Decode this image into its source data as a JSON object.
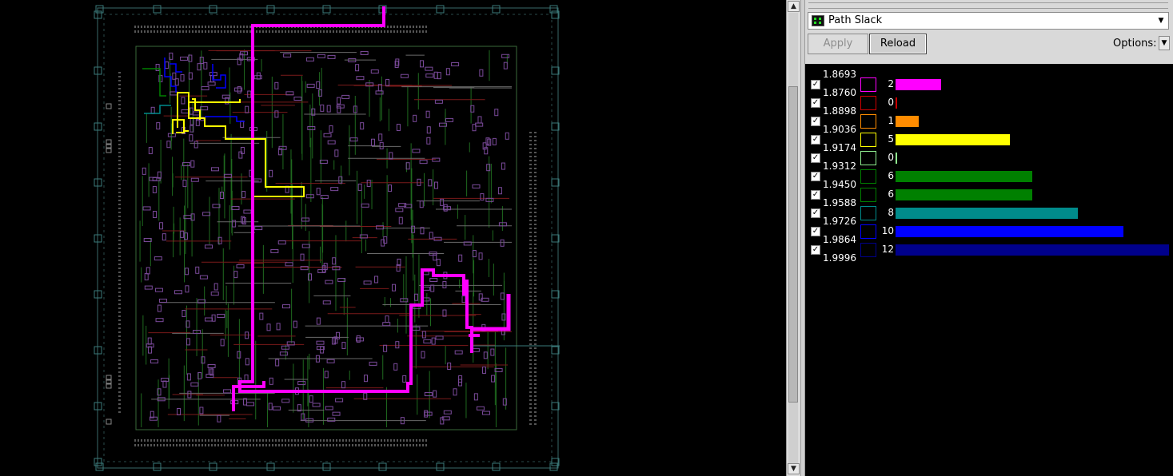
{
  "layout_view": {
    "colors": {
      "background": "#000000",
      "core_outline": "#3a6a3a",
      "io_pads": "#3a7a7a",
      "cells": "#7a4a9a",
      "green_routes": "#1f6a1f",
      "red_routes": "#7a1a1a",
      "gray_routes": "#6a6a6a",
      "path_magenta": "#ff00ff",
      "path_yellow": "#ffff00",
      "path_blue": "#0000ff",
      "path_teal": "#008b8b",
      "path_green": "#008000"
    }
  },
  "panel": {
    "dropdown": {
      "icon": "grid-icon",
      "selected": "Path Slack",
      "arrow_icon": "chevron-down-icon"
    },
    "apply_label": "Apply",
    "reload_label": "Reload",
    "options_label": "Options:",
    "options_arrow_icon": "chevron-down-icon"
  },
  "slack_labels": [
    "1.8693",
    "1.8760",
    "1.8898",
    "1.9036",
    "1.9174",
    "1.9312",
    "1.9450",
    "1.9588",
    "1.9726",
    "1.9864",
    "1.9996"
  ],
  "legend": {
    "max_count": 12,
    "rows": [
      {
        "count": "2",
        "count_value": 2,
        "color": "#ff00ff",
        "checked": true
      },
      {
        "count": "0",
        "count_value": 0,
        "color": "#cc0000",
        "checked": true
      },
      {
        "count": "1",
        "count_value": 1,
        "color": "#ff8c00",
        "checked": true
      },
      {
        "count": "5",
        "count_value": 5,
        "color": "#ffff00",
        "checked": true
      },
      {
        "count": "0",
        "count_value": 0,
        "color": "#90ee90",
        "checked": true
      },
      {
        "count": "6",
        "count_value": 6,
        "color": "#008000",
        "checked": true
      },
      {
        "count": "6",
        "count_value": 6,
        "color": "#008000",
        "checked": true
      },
      {
        "count": "8",
        "count_value": 8,
        "color": "#008b8b",
        "checked": true
      },
      {
        "count": "10",
        "count_value": 10,
        "color": "#0000ff",
        "checked": true
      },
      {
        "count": "12",
        "count_value": 12,
        "color": "#00008b",
        "checked": true
      }
    ]
  },
  "scrollbar": {
    "up_icon": "arrow-up-icon",
    "down_icon": "arrow-down-icon"
  }
}
